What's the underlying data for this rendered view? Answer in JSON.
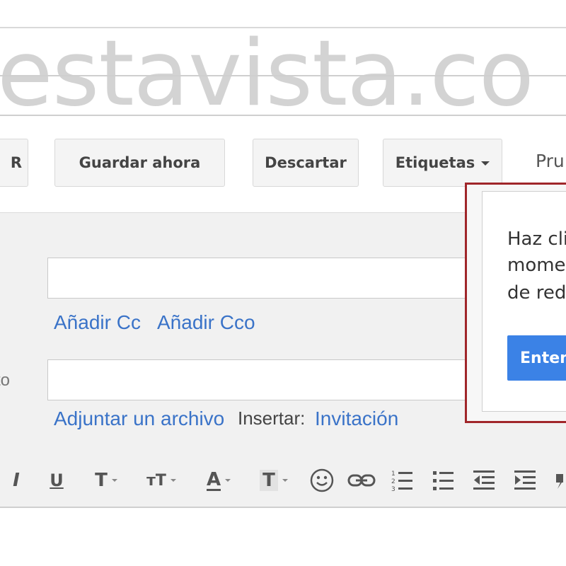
{
  "watermark": {
    "text": "estavista.co"
  },
  "toolbar": {
    "send_label": "R",
    "save_label": "Guardar ahora",
    "discard_label": "Descartar",
    "labels_label": "Etiquetas",
    "more_label": "Pru"
  },
  "compose": {
    "to_label": "",
    "subject_label": "to",
    "to_value": "",
    "subject_value": "",
    "add_cc": "Añadir Cc",
    "add_bcc": "Añadir Cco",
    "attach": "Adjuntar un archivo",
    "insert_label": "Insertar:",
    "invite": "Invitación"
  },
  "format_bar": {
    "italic": "I",
    "underline": "U",
    "font": "T",
    "font_size": "тT",
    "text_color": "A",
    "highlight": "T"
  },
  "tooltip": {
    "line1": "Haz cli",
    "line2": "momen",
    "line3": "de reda",
    "button": "Enten"
  },
  "colors": {
    "link": "#3a73c8",
    "tooltip_border": "#a0262a",
    "primary_button": "#3b82e6"
  },
  "icons": [
    "caret-down-icon",
    "italic-icon",
    "underline-icon",
    "font-icon",
    "font-size-icon",
    "text-color-icon",
    "highlight-icon",
    "emoji-icon",
    "link-icon",
    "numbered-list-icon",
    "bulleted-list-icon",
    "indent-less-icon",
    "indent-more-icon"
  ]
}
